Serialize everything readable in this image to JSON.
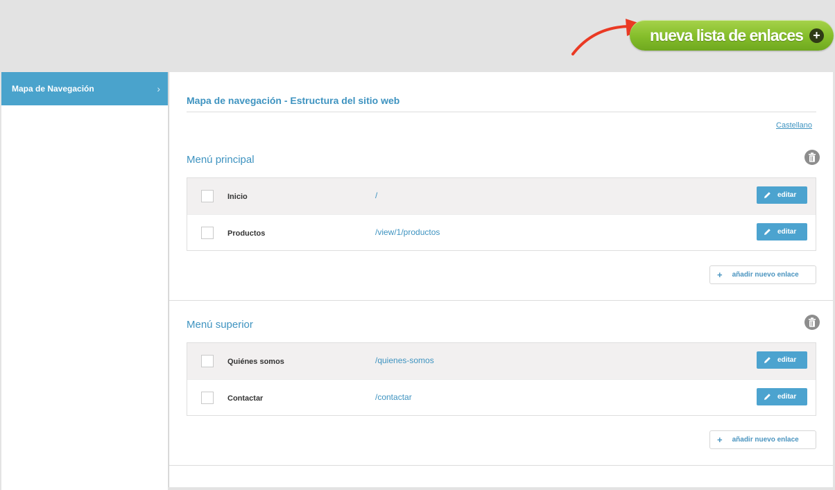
{
  "header": {
    "new_list_button": "nueva lista de enlaces",
    "new_list_button_icon": "+"
  },
  "sidebar": {
    "items": [
      {
        "label": "Mapa de Navegación",
        "icon": "chevron-right-icon",
        "glyph": "›"
      }
    ]
  },
  "main": {
    "title": "Mapa de navegación - Estructura del sitio web",
    "language_link": "Castellano",
    "sections": [
      {
        "title": "Menú principal",
        "add_link_label": "añadir nuevo enlace",
        "add_link_icon": "+",
        "rows": [
          {
            "name": "Inicio",
            "url": "/",
            "edit_label": "editar"
          },
          {
            "name": "Productos",
            "url": "/view/1/productos",
            "edit_label": "editar"
          }
        ]
      },
      {
        "title": "Menú superior",
        "add_link_label": "añadir nuevo enlace",
        "add_link_icon": "+",
        "rows": [
          {
            "name": "Quiénes somos",
            "url": "/quienes-somos",
            "edit_label": "editar"
          },
          {
            "name": "Contactar",
            "url": "/contactar",
            "edit_label": "editar"
          }
        ]
      }
    ]
  },
  "colors": {
    "accent_blue": "#4aa3cc",
    "brand_green": "#84bd2a",
    "annotation_red": "#ea3a24"
  }
}
